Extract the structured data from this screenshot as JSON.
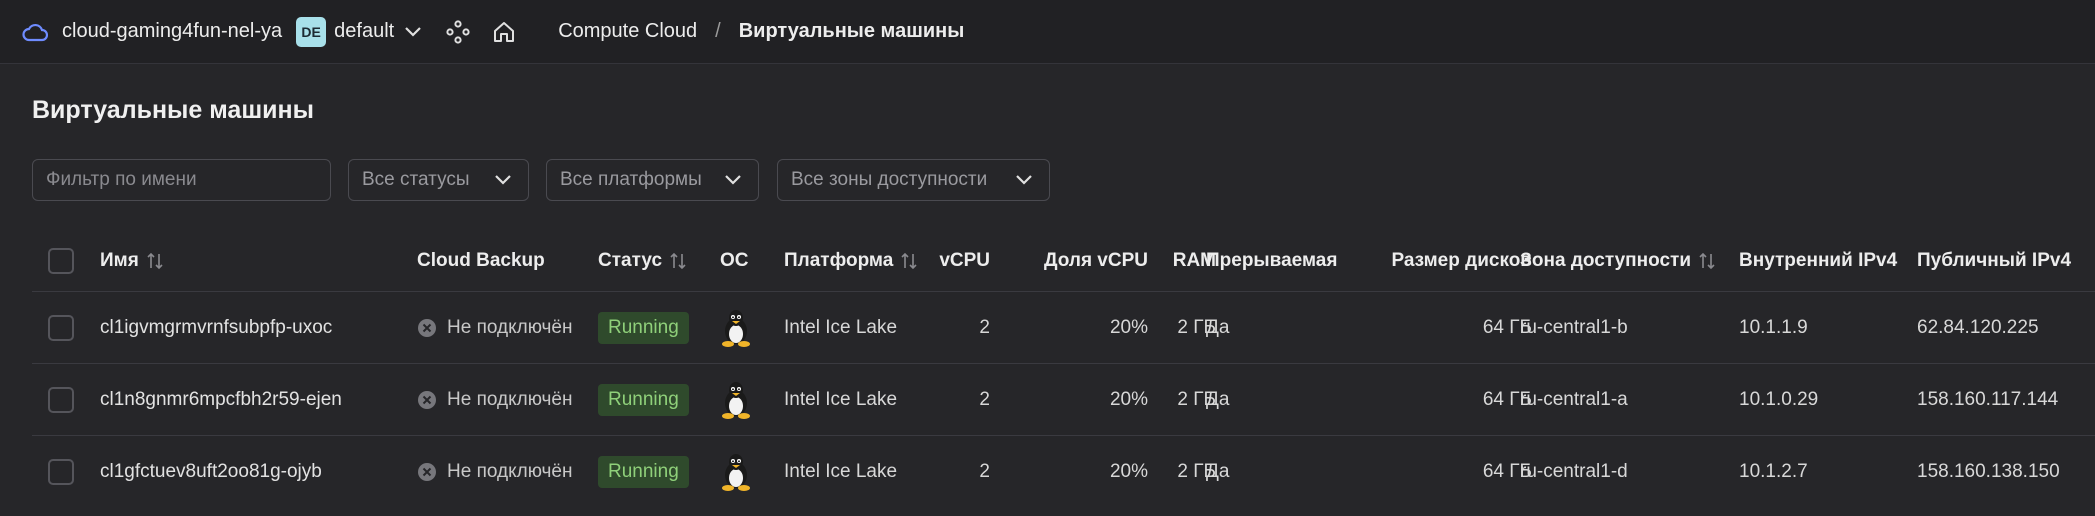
{
  "topbar": {
    "cloud_name": "cloud-gaming4fun-nel-ya",
    "folder_badge": "DE",
    "folder_name": "default",
    "breadcrumbs": [
      "Compute Cloud",
      "Виртуальные машины"
    ],
    "separator": "/"
  },
  "page": {
    "title": "Виртуальные машины"
  },
  "filters": {
    "name_placeholder": "Фильтр по имени",
    "status_select": "Все статусы",
    "platform_select": "Все платформы",
    "zone_select": "Все зоны доступности"
  },
  "table": {
    "columns": {
      "name": "Имя",
      "backup": "Cloud Backup",
      "status": "Статус",
      "os": "ОС",
      "platform": "Платформа",
      "vcpu": "vCPU",
      "vcpu_share": "Доля vCPU",
      "ram": "RAM",
      "preemptible": "Прерываемая",
      "disk_size": "Размер дисков",
      "zone": "Зона доступности",
      "internal_ip": "Внутренний IPv4",
      "public_ip": "Публичный IPv4"
    },
    "rows": [
      {
        "name": "cl1igvmgrmvrnfsubpfp-uxoc",
        "backup": "Не подключён",
        "status": "Running",
        "os_icon": "linux-tux-icon",
        "platform": "Intel Ice Lake",
        "vcpu": "2",
        "vcpu_share": "20%",
        "ram": "2 ГБ",
        "preemptible": "Да",
        "disk_size": "64 ГБ",
        "zone": "ru-central1-b",
        "internal_ip": "10.1.1.9",
        "public_ip": "62.84.120.225"
      },
      {
        "name": "cl1n8gnmr6mpcfbh2r59-ejen",
        "backup": "Не подключён",
        "status": "Running",
        "os_icon": "linux-tux-icon",
        "platform": "Intel Ice Lake",
        "vcpu": "2",
        "vcpu_share": "20%",
        "ram": "2 ГБ",
        "preemptible": "Да",
        "disk_size": "64 ГБ",
        "zone": "ru-central1-a",
        "internal_ip": "10.1.0.29",
        "public_ip": "158.160.117.144"
      },
      {
        "name": "cl1gfctuev8uft2oo81g-ojyb",
        "backup": "Не подключён",
        "status": "Running",
        "os_icon": "linux-tux-icon",
        "platform": "Intel Ice Lake",
        "vcpu": "2",
        "vcpu_share": "20%",
        "ram": "2 ГБ",
        "preemptible": "Да",
        "disk_size": "64 ГБ",
        "zone": "ru-central1-d",
        "internal_ip": "10.1.2.7",
        "public_ip": "158.160.138.150"
      }
    ]
  },
  "colors": {
    "background": "#262629",
    "status_running_bg": "#2f4a2c",
    "status_running_text": "#8fd07a",
    "folder_badge_bg": "#a8e0ea"
  }
}
